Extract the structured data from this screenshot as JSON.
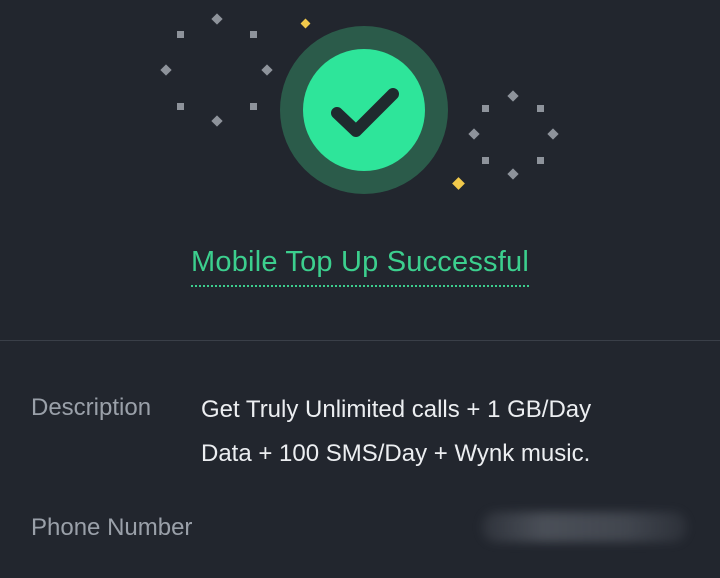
{
  "status": {
    "title": "Mobile Top Up Successful",
    "icon": "check-circle-icon",
    "accent_color": "#2ee59a",
    "ring_color": "#2b5b4a",
    "check_color": "#1f2a2e",
    "sparkle_gray": "#8e939b",
    "sparkle_yellow": "#f1c94b"
  },
  "details": {
    "description_label": "Description",
    "description_line1": "Get Truly Unlimited calls + 1 GB/Day",
    "description_line2": "Data + 100 SMS/Day + Wynk music.",
    "phone_label": "Phone Number"
  }
}
